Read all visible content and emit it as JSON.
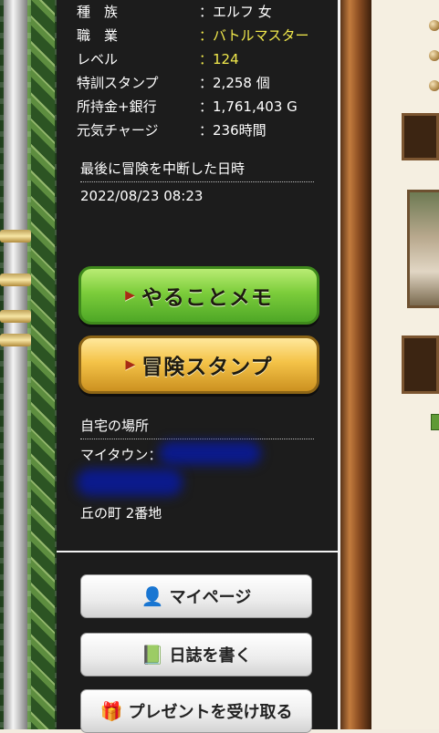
{
  "profile": {
    "race_label": "種　族",
    "race_value": "エルフ 女",
    "job_label": "職　業",
    "job_value": "バトルマスター",
    "level_label": "レベル",
    "level_value": "124",
    "stamp_label": "特訓スタンプ",
    "stamp_value": "2,258 個",
    "gold_label": "所持金+銀行",
    "gold_value": "1,761,403 G",
    "charge_label": "元気チャージ",
    "charge_value": "236時間",
    "colon": "："
  },
  "last_adventure": {
    "heading": "最後に冒険を中断した日時",
    "datetime": "2022/08/23 08:23"
  },
  "buttons": {
    "todo_memo": "やることメモ",
    "adventure_stamp": "冒険スタンプ"
  },
  "home": {
    "heading": "自宅の場所",
    "mytown_label": "マイタウン：",
    "address": "丘の町 2番地"
  },
  "menu": {
    "mypage": "マイページ",
    "diary": "日誌を書く",
    "present": "プレゼントを受け取る"
  },
  "icons": {
    "person": "person-icon",
    "diary": "diary-icon",
    "gift": "gift-icon"
  },
  "colors": {
    "highlight": "#f2ea4c",
    "panel_bg": "#1c1c1c"
  }
}
